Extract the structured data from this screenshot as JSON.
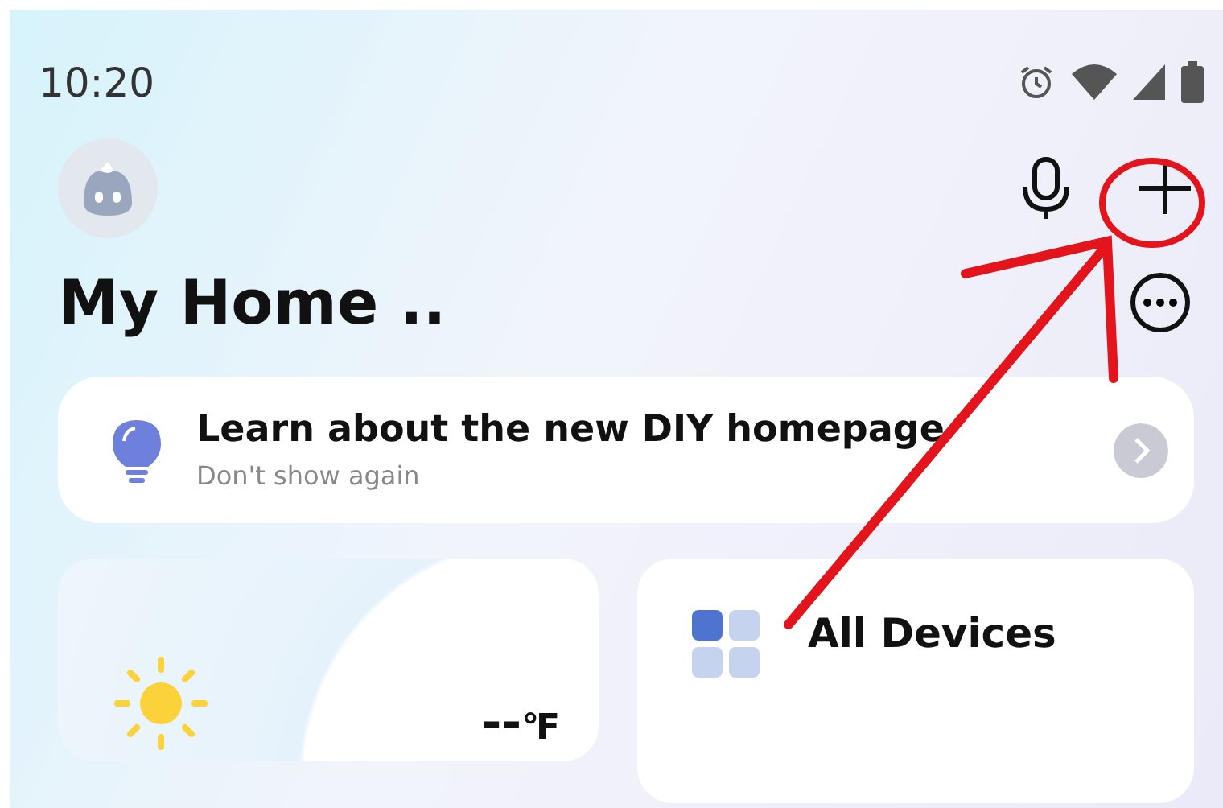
{
  "status_bar": {
    "time": "10:20"
  },
  "header": {
    "title": "My Home .."
  },
  "banner": {
    "title": "Learn about the new DIY homepage",
    "subtitle": "Don't show again"
  },
  "tiles": [
    {
      "kind": "weather",
      "temperature": "--",
      "unit": "℉"
    },
    {
      "kind": "devices",
      "label": "All Devices"
    }
  ]
}
